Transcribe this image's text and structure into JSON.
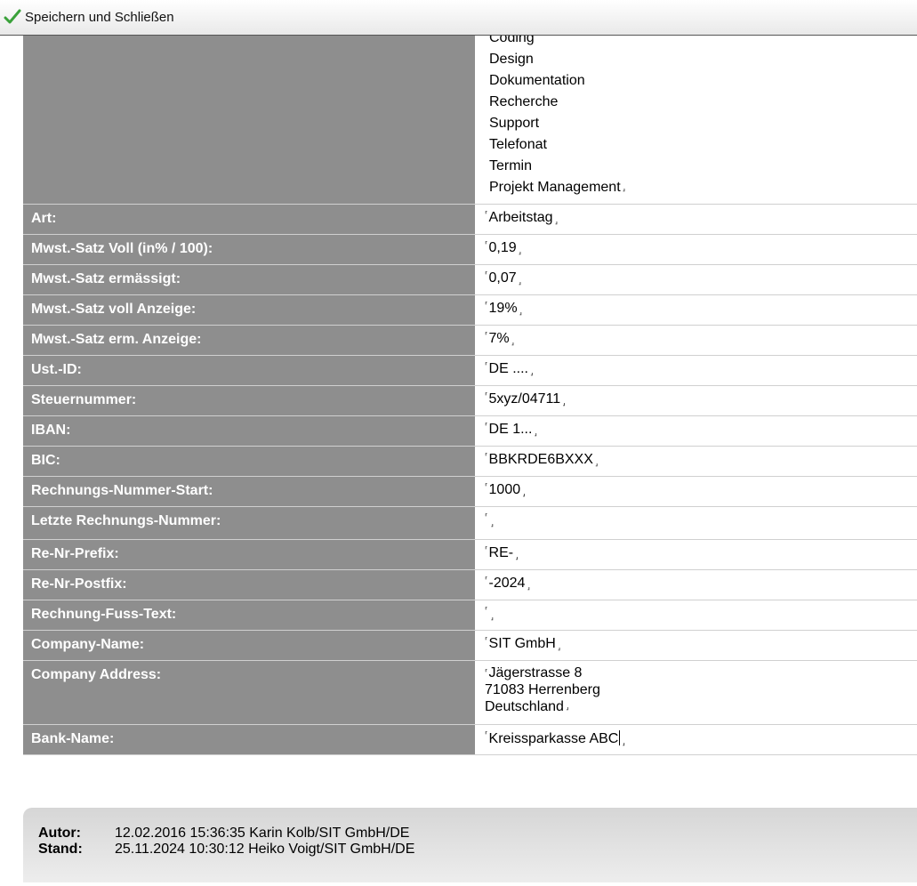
{
  "toolbar": {
    "save_label": "Speichern und Schließen",
    "icon": "checkmark-icon",
    "icon_color": "#3aa13a"
  },
  "categories": [
    "Coding",
    "Design",
    "Dokumentation",
    "Recherche",
    "Support",
    "Telefonat",
    "Termin",
    "Projekt Management"
  ],
  "fields": [
    {
      "label": "Art:",
      "value": "Arbeitstag"
    },
    {
      "label": "Mwst.-Satz Voll (in% / 100):",
      "value": "0,19"
    },
    {
      "label": "Mwst.-Satz ermässigt:",
      "value": "0,07"
    },
    {
      "label": "Mwst.-Satz voll Anzeige:",
      "value": "19%"
    },
    {
      "label": "Mwst.-Satz erm. Anzeige:",
      "value": "7%"
    },
    {
      "label": "Ust.-ID:",
      "value": "DE ...."
    },
    {
      "label": "Steuernummer:",
      "value": "5xyz/04711"
    },
    {
      "label": "IBAN:",
      "value": "DE 1..."
    },
    {
      "label": "BIC:",
      "value": "BBKRDE6BXXX"
    },
    {
      "label": "Rechnungs-Nummer-Start:",
      "value": "1000"
    },
    {
      "label": "Letzte Rechnungs-Nummer:",
      "value": ""
    },
    {
      "label": "Re-Nr-Prefix:",
      "value": "RE-"
    },
    {
      "label": "Re-Nr-Postfix:",
      "value": "-2024"
    },
    {
      "label": "Rechnung-Fuss-Text:",
      "value": ""
    },
    {
      "label": "Company-Name:",
      "value": "SIT GmbH"
    },
    {
      "label": "Company Address:",
      "value_lines": [
        "Jägerstrasse 8",
        "71083 Herrenberg",
        "Deutschland"
      ]
    },
    {
      "label": "Bank-Name:",
      "value": "Kreissparkasse ABC"
    }
  ],
  "field_markers": {
    "open": "⸢",
    "close": "⸥"
  },
  "footer": {
    "author_label": "Autor:",
    "author_value": "12.02.2016 15:36:35 Karin Kolb/SIT GmbH/DE",
    "status_label": "Stand:",
    "status_value": "25.11.2024 10:30:12 Heiko Voigt/SIT GmbH/DE"
  },
  "colors": {
    "label_bg": "#8e8e8e",
    "label_text": "#ffffff"
  }
}
